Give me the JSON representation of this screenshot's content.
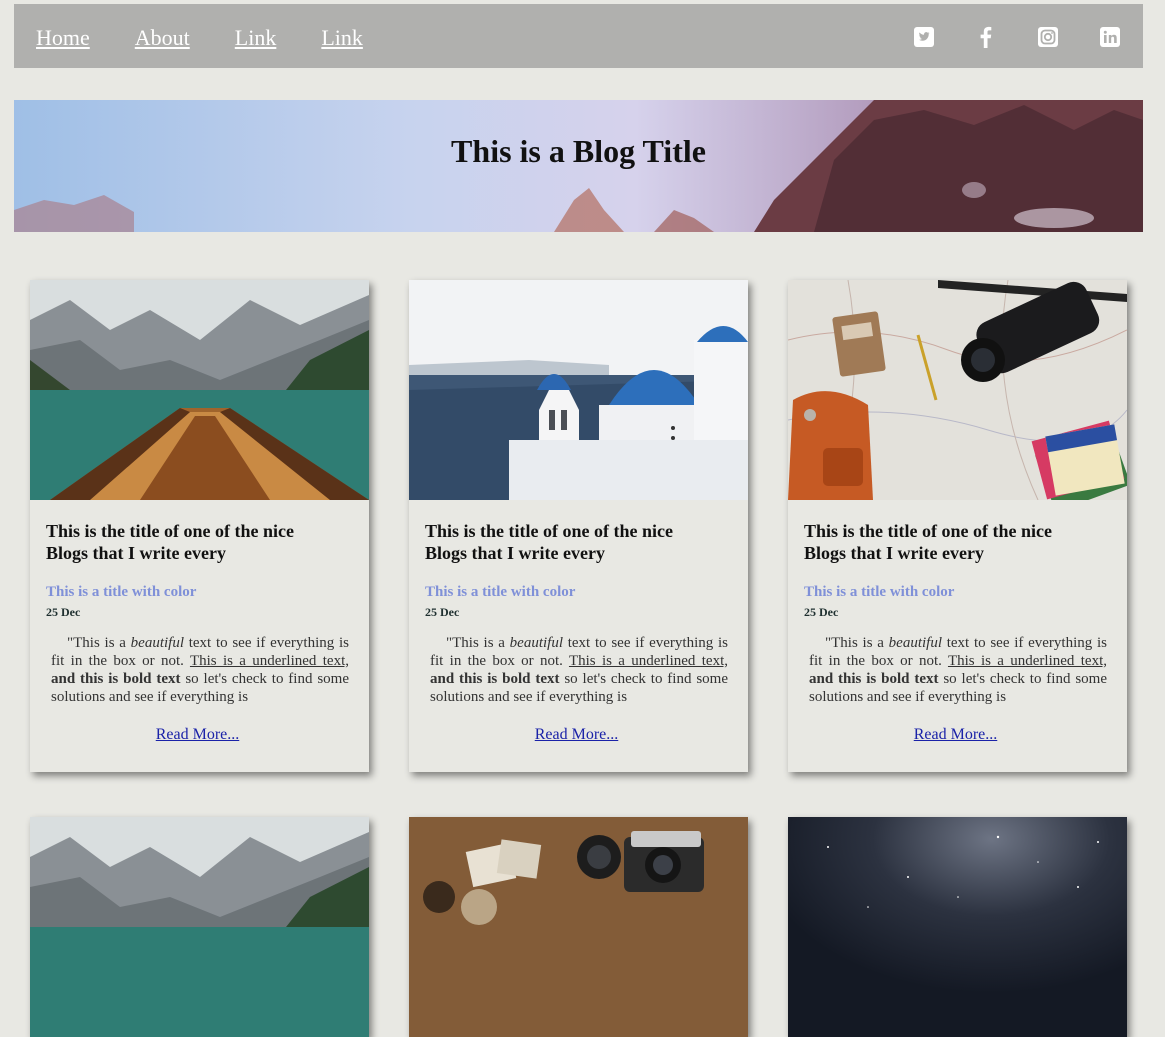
{
  "nav": {
    "links": [
      "Home",
      "About",
      "Link",
      "Link"
    ],
    "social": [
      "twitter-icon",
      "facebook-icon",
      "instagram-icon",
      "linkedin-icon"
    ]
  },
  "hero": {
    "title": "This is a Blog Title"
  },
  "card": {
    "title": "This is the title of one of the nice Blogs that I write every",
    "subtitle": "This is a title with color",
    "date": "25 Dec",
    "text_start": "\"This is a ",
    "text_italic": "beautiful",
    "text_mid": " text to see if everything is fit in the box or not. ",
    "text_underline": "This is a underlined text,",
    "text_bold": " and this is bold text",
    "text_end": " so let's check to find some solutions and see if everything is",
    "read_more": "Read More..."
  },
  "cards": [
    {
      "image": "mountain-lake-boat-image"
    },
    {
      "image": "santorini-church-image"
    },
    {
      "image": "travel-map-camera-image"
    },
    {
      "image": "mountain-lake-image"
    },
    {
      "image": "vintage-camera-map-image"
    },
    {
      "image": "starry-night-sky-image"
    }
  ],
  "colors": {
    "navbar": "#b0b0ae",
    "page_bg": "#e8e8e3",
    "subtitle": "#7f90d8",
    "link": "#1a22a8"
  }
}
